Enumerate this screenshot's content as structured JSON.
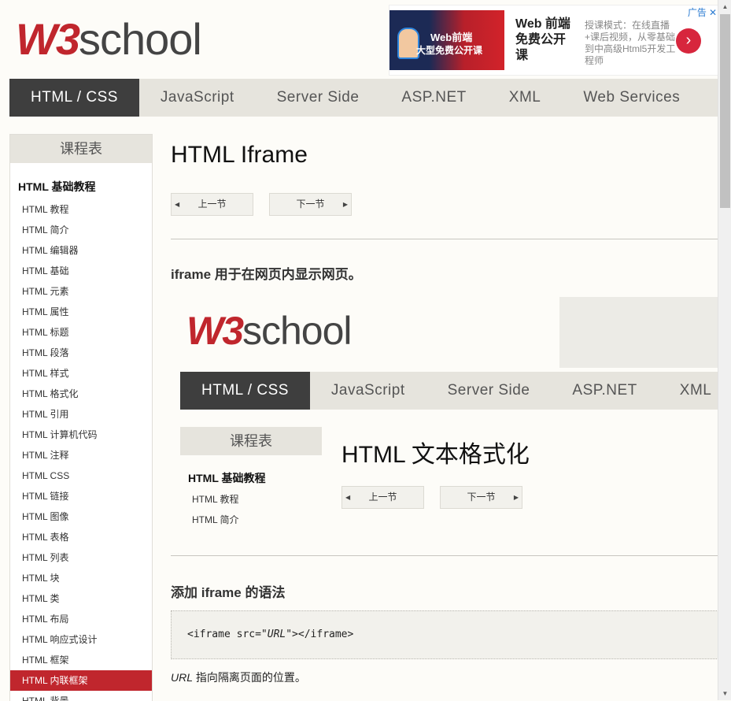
{
  "logo": {
    "w3": "W3",
    "school": "school"
  },
  "ad": {
    "image_line1": "Web前端",
    "image_line2": "大型免费公开课",
    "title": "Web 前端免费公开课",
    "desc": "授课模式：在线直播+课后视频，从零基础到中高级Html5开发工程师",
    "tag": "广告",
    "close": "✕",
    "go_icon": "›"
  },
  "nav": {
    "items": [
      "HTML / CSS",
      "JavaScript",
      "Server Side",
      "ASP.NET",
      "XML",
      "Web Services"
    ]
  },
  "sidebar": {
    "header": "课程表",
    "section": "HTML 基础教程",
    "items": [
      "HTML 教程",
      "HTML 简介",
      "HTML 编辑器",
      "HTML 基础",
      "HTML 元素",
      "HTML 属性",
      "HTML 标题",
      "HTML 段落",
      "HTML 样式",
      "HTML 格式化",
      "HTML 引用",
      "HTML 计算机代码",
      "HTML 注释",
      "HTML CSS",
      "HTML 链接",
      "HTML 图像",
      "HTML 表格",
      "HTML 列表",
      "HTML 块",
      "HTML 类",
      "HTML 布局",
      "HTML 响应式设计",
      "HTML 框架",
      "HTML 内联框架",
      "HTML 背景"
    ]
  },
  "main": {
    "title": "HTML Iframe",
    "prev": "上一节",
    "next": "下一节",
    "intro": "iframe 用于在网页内显示网页。",
    "syntax_heading": "添加 iframe 的语法",
    "code_open": "<iframe src=\"",
    "code_url": "URL",
    "code_close": "\"></iframe>",
    "note_url": "URL",
    "note_text": " 指向隔离页面的位置。"
  },
  "iframe": {
    "nav": [
      "HTML / CSS",
      "JavaScript",
      "Server Side",
      "ASP.NET",
      "XML"
    ],
    "side_header": "课程表",
    "side_section": "HTML 基础教程",
    "side_items": [
      "HTML 教程",
      "HTML 简介"
    ],
    "title": "HTML 文本格式化",
    "prev": "上一节",
    "next": "下一节"
  },
  "colors": {
    "brand_red": "#c0262d",
    "nav_active": "#3e3e3e",
    "nav_bg": "#e6e4dd"
  }
}
